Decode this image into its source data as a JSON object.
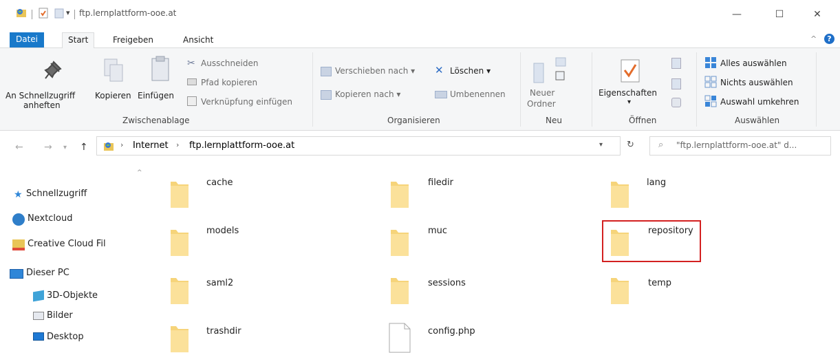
{
  "window": {
    "title": "ftp.lernplattform-ooe.at",
    "minimize_glyph": "—",
    "maximize_glyph": "☐",
    "close_glyph": "✕"
  },
  "tabs": [
    "Datei",
    "Start",
    "Freigeben",
    "Ansicht"
  ],
  "ribbon": {
    "clipboard": {
      "pin_label_1": "An Schnellzugriff",
      "pin_label_2": "anheften",
      "copy": "Kopieren",
      "paste": "Einfügen",
      "cut": "Ausschneiden",
      "copy_path": "Pfad kopieren",
      "paste_shortcut": "Verknüpfung einfügen",
      "group": "Zwischenablage"
    },
    "organize": {
      "move_to": "Verschieben nach",
      "copy_to": "Kopieren nach",
      "delete": "Löschen",
      "rename": "Umbenennen",
      "group": "Organisieren"
    },
    "new": {
      "new_folder_1": "Neuer",
      "new_folder_2": "Ordner",
      "group": "Neu"
    },
    "open": {
      "properties": "Eigenschaften",
      "group": "Öffnen"
    },
    "select": {
      "select_all": "Alles auswählen",
      "select_none": "Nichts auswählen",
      "invert": "Auswahl umkehren",
      "group": "Auswählen"
    }
  },
  "address": {
    "crumb_1": "Internet",
    "crumb_2": "ftp.lernplattform-ooe.at",
    "search_placeholder": "\"ftp.lernplattform-ooe.at\" d..."
  },
  "nav": {
    "items": [
      "Schnellzugriff",
      "Nextcloud",
      "Creative Cloud Fil",
      "Dieser PC",
      "3D-Objekte",
      "Bilder",
      "Desktop"
    ]
  },
  "files": [
    {
      "name": "cache",
      "type": "folder"
    },
    {
      "name": "filedir",
      "type": "folder"
    },
    {
      "name": "lang",
      "type": "folder"
    },
    {
      "name": "models",
      "type": "folder"
    },
    {
      "name": "muc",
      "type": "folder"
    },
    {
      "name": "repository",
      "type": "folder",
      "highlighted": true
    },
    {
      "name": "saml2",
      "type": "folder"
    },
    {
      "name": "sessions",
      "type": "folder"
    },
    {
      "name": "temp",
      "type": "folder"
    },
    {
      "name": "trashdir",
      "type": "folder"
    },
    {
      "name": "config.php",
      "type": "file"
    }
  ],
  "colors": {
    "accent": "#1979ca",
    "folder": "#f6d47a",
    "highlight": "#d32020"
  }
}
